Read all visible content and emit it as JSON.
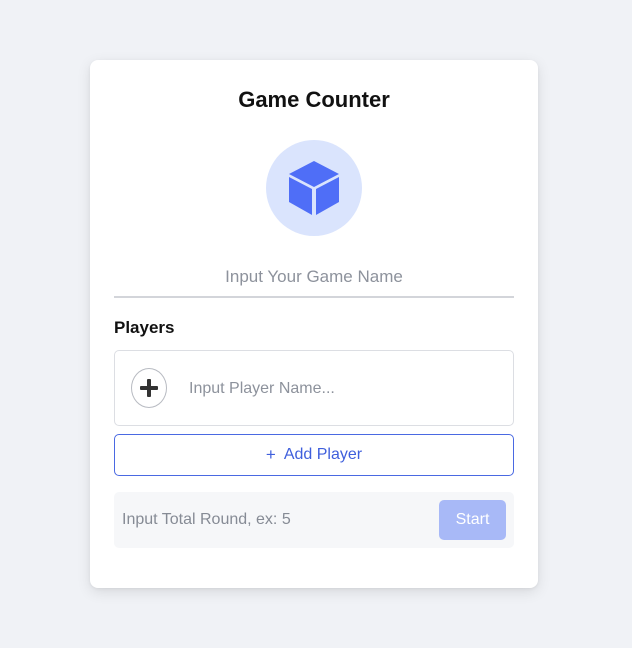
{
  "app": {
    "title": "Game Counter",
    "logo_icon": "cube-icon",
    "accent_color": "#4f6ef7"
  },
  "game_name": {
    "placeholder": "Input Your Game Name",
    "value": ""
  },
  "players": {
    "label": "Players",
    "add_circle_icon": "plus-icon",
    "player_input_placeholder": "Input Player Name...",
    "player_input_value": "",
    "add_button_icon": "+",
    "add_button_label": "Add Player"
  },
  "rounds": {
    "placeholder": "Input Total Round, ex: 5",
    "value": "",
    "start_label": "Start",
    "start_disabled": true
  }
}
